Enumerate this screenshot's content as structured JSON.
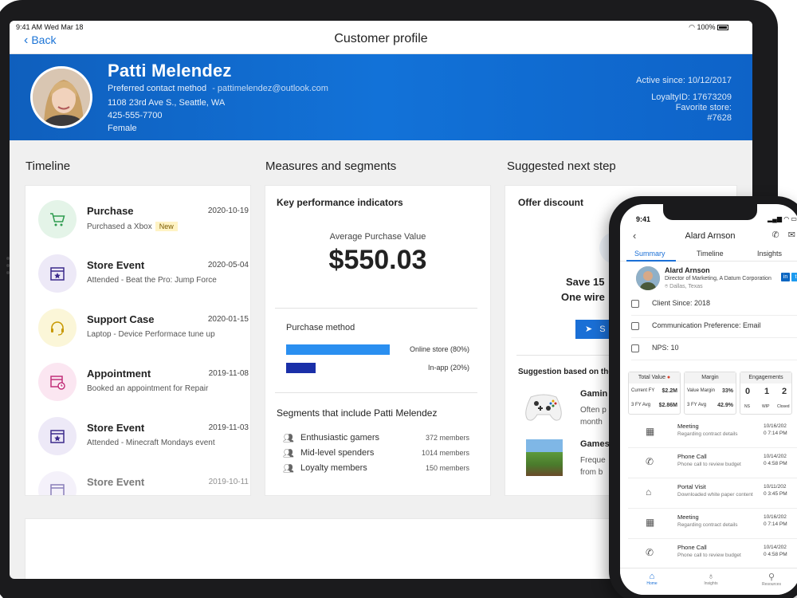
{
  "tablet": {
    "status": {
      "time_date": "9:41 AM  Wed Mar 18",
      "battery": "100%"
    },
    "nav": {
      "back_label": "Back",
      "title": "Customer profile"
    },
    "profile": {
      "name": "Patti Melendez",
      "contact_label": "Preferred contact method",
      "contact_value": "- pattimelendez@outlook.com",
      "address": "1108 23rd Ave S., Seattle, WA",
      "phone": "425-555-7700",
      "gender": "Female",
      "active_since": "Active since: 10/12/2017",
      "loyalty_id": "LoyaltyID: 17673209",
      "favorite_store_label": "Favorite store:",
      "favorite_store_value": "#7628"
    },
    "sections": {
      "timeline": "Timeline",
      "measures": "Measures and segments",
      "suggested": "Suggested next step"
    },
    "timeline": [
      {
        "title": "Purchase",
        "date": "2020-10-19",
        "sub": "Purchased a Xbox",
        "badge": "New",
        "icon": "cart-icon"
      },
      {
        "title": "Store Event",
        "date": "2020-05-04",
        "sub": "Attended - Beat the Pro: Jump Force",
        "icon": "calendar-star-icon"
      },
      {
        "title": "Support Case",
        "date": "2020-01-15",
        "sub": "Laptop - Device Performace tune up",
        "icon": "headset-icon"
      },
      {
        "title": "Appointment",
        "date": "2019-11-08",
        "sub": "Booked an appointment for Repair",
        "icon": "calendar-clock-icon"
      },
      {
        "title": "Store Event",
        "date": "2019-11-03",
        "sub": "Attended - Minecraft Mondays event",
        "icon": "calendar-star-icon"
      },
      {
        "title": "Store Event",
        "date": "2019-10-11",
        "sub": "",
        "icon": "calendar-star-icon"
      }
    ],
    "kpi": {
      "heading": "Key performance indicators",
      "label": "Average Purchase Value",
      "value": "$550.03",
      "purchase_method_label": "Purchase method",
      "methods": [
        {
          "label": "Online store (80%)",
          "percent": 80,
          "color": "#2a8ff0"
        },
        {
          "label": "In-app (20%)",
          "percent": 20,
          "color": "#1a2fa8"
        }
      ],
      "segments_heading": "Segments that include Patti Melendez",
      "segments": [
        {
          "name": "Enthusiastic gamers",
          "count": "372 members"
        },
        {
          "name": "Mid-level spenders",
          "count": "1014 members"
        },
        {
          "name": "Loyalty members",
          "count": "150 members"
        }
      ]
    },
    "suggested": {
      "offer_title": "Offer discount",
      "offer_line1": "Save 15",
      "offer_line2": "One wire",
      "send_label": "S",
      "suggestion_heading": "Suggestion based on the",
      "items": [
        {
          "title": "Gamin",
          "sub1": "Often p",
          "sub2": "month"
        },
        {
          "title": "Games",
          "sub1": "Freque",
          "sub2": "from b"
        }
      ]
    }
  },
  "phone": {
    "time": "9:41",
    "title": "Alard Arnson",
    "tabs": [
      "Summary",
      "Timeline",
      "Insights"
    ],
    "contact": {
      "name": "Alard Arnson",
      "role": "Director of Marketing, A Datum Corporation",
      "location": "Dallas, Texas"
    },
    "rows": [
      "Client Since: 2018",
      "Communication Preference: Email",
      "NPS: 10"
    ],
    "cards": {
      "total_value": {
        "title": "Total Value",
        "r1_label": "Current FY",
        "r1_value": "$2.2M",
        "r2_label": "3 FY Avg",
        "r2_value": "$2.86M"
      },
      "margin": {
        "title": "Margin",
        "r1_label": "Value Margin",
        "r1_value": "33%",
        "r2_label": "3 FY Avg",
        "r2_value": "42.9%"
      },
      "engagements": {
        "title": "Engagements",
        "ns": "0",
        "ns_label": "NS",
        "wip": "1",
        "wip_label": "WIP",
        "closed": "2",
        "closed_label": "Closed"
      }
    },
    "activities": [
      {
        "title": "Meeting",
        "sub": "Regarding contract details",
        "date": "10/16/202",
        "time": "0 7:14 PM",
        "icon": "meeting-icon"
      },
      {
        "title": "Phone Call",
        "sub": "Phone call to review budget",
        "date": "10/14/202",
        "time": "0 4:58 PM",
        "icon": "phone-call-icon"
      },
      {
        "title": "Portal Visit",
        "sub": "Downloaded white paper content",
        "date": "10/11/202",
        "time": "0 3:45 PM",
        "icon": "portal-icon"
      },
      {
        "title": "Meeting",
        "sub": "Regarding contract details",
        "date": "10/16/202",
        "time": "0 7:14 PM",
        "icon": "meeting-icon"
      },
      {
        "title": "Phone Call",
        "sub": "Phone call to review budget",
        "date": "10/14/202",
        "time": "0 4:58 PM",
        "icon": "phone-call-icon"
      }
    ],
    "bottom_nav": [
      "Home",
      "Insights",
      "Resources"
    ]
  },
  "colors": {
    "hero_blue": "#1272d8",
    "accent": "#1a6fd6"
  }
}
